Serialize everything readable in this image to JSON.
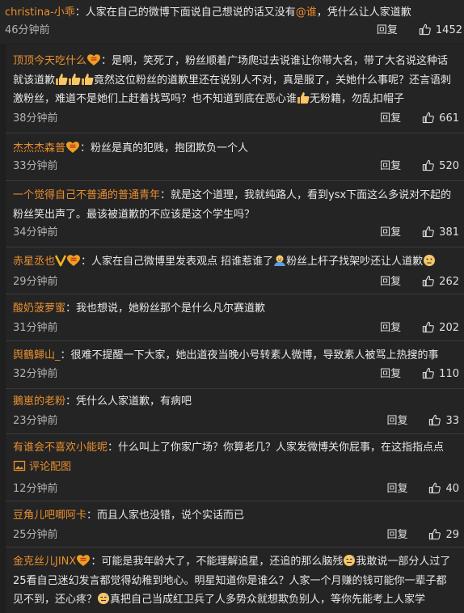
{
  "post": {
    "user": "christina-小乖",
    "sep": "：",
    "text_a": "人家在自己的微博下面说自己想说的话又没有",
    "mention": "@谁",
    "text_b": "，凭什么让人家道歉",
    "time": "46分钟前",
    "reply_label": "回复",
    "likes": "1452"
  },
  "replies": [
    {
      "user": "顶顶今天吃什么",
      "text_a": "：是啊，笑死了，粉丝顺着广场爬过去说谁让你带大名，带了大名说这种话就该道歉",
      "text_b": "竟然这位粉丝的道歉里还在说别人不对，真是服了，关她什么事呢？还言语刺激粉丝，难道不是她们上赶着找骂吗？也不知道到底在恶心谁",
      "text_c": "无粉籍，勿乱扣帽子",
      "time": "38分钟前",
      "reply_label": "回复",
      "likes": "661"
    },
    {
      "user": "杰杰杰森普",
      "text_a": "：粉丝是真的犯贱，抱团欺负一个人",
      "time": "33分钟前",
      "reply_label": "回复",
      "likes": "520"
    },
    {
      "user": "一个觉得自己不普通的普通青年",
      "text_a": "：就是这个道理，我就纯路人，看到ysx下面这么多说对不起的粉丝笑出声了。最该被道歉的不应该是这个学生吗？",
      "time": "34分钟前",
      "reply_label": "回复",
      "likes": "381"
    },
    {
      "user": "赤星丞也",
      "text_a": "：人家在自己微博里发表观点 招谁惹谁了",
      "text_b": "粉丝上杆子找架吵还让人道歉",
      "time": "29分钟前",
      "reply_label": "回复",
      "likes": "262"
    },
    {
      "user": "酸奶菠萝蜜",
      "text_a": "：我也想说，她粉丝那个是什么凡尔赛道歉",
      "time": "31分钟前",
      "reply_label": "回复",
      "likes": "202"
    },
    {
      "user": "舆鶴歸山_",
      "text_a": "：很难不提醒一下大家，她出道夜当晚小号转素人微博，导致素人被骂上热搜的事",
      "time": "32分钟前",
      "reply_label": "回复",
      "likes": "110"
    },
    {
      "user": "鵝崽的老粉",
      "text_a": "：凭什么人家道歉，有病吧",
      "time": "23分钟前",
      "reply_label": "回复",
      "likes": "33"
    },
    {
      "user": "有谁会不喜欢小能呢",
      "text_a": "：什么叫上了你家广场？你算老几？人家发微博关你屁事，在这指指点点",
      "pic_label": "评论配图",
      "time": "12分钟前",
      "reply_label": "回复",
      "likes": "40"
    },
    {
      "user": "豆角儿吧唧阿卡",
      "text_a": "：而且人家也没错，说个实话而已",
      "time": "25分钟前",
      "reply_label": "回复",
      "likes": "29"
    },
    {
      "user": "金克丝儿JINX",
      "text_a": "：可能是我年龄大了，不能理解追星，还追的那么脑残",
      "text_b": "我敢说一部分人过了25看自己迷幻发言都觉得幼稚到地心。明星知道你是谁么？人家一个月赚的钱可能你一辈子都见不到，还心疼？",
      "text_c": "真把自己当成红卫兵了人多势众就想欺负别人，等你先能考上人家学"
    }
  ],
  "colors": {
    "username": "#e88f2f",
    "background": "#1f1f1f",
    "panel": "#242424",
    "text": "#e8e8e8",
    "muted": "#b3b3b3"
  }
}
